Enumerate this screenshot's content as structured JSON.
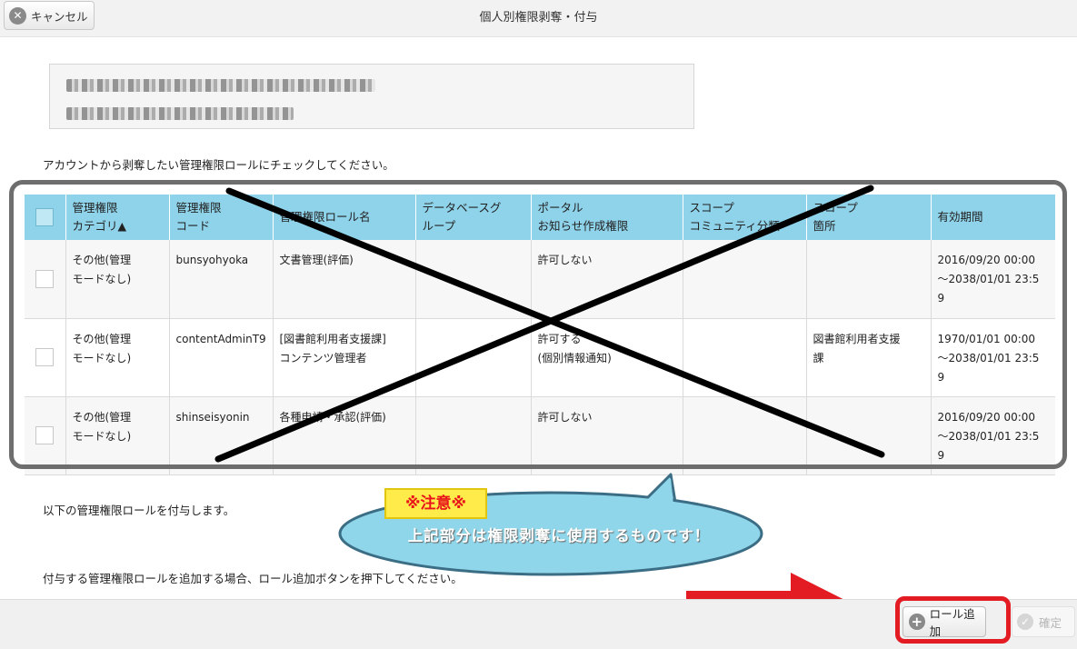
{
  "header": {
    "cancel_label": "キャンセル",
    "title": "個人別権限剥奪・付与"
  },
  "instructions": {
    "revoke": "アカウントから剥奪したい管理権限ロールにチェックしてください。",
    "grant": "以下の管理権限ロールを付与します。",
    "add_hint": "付与する管理権限ロールを追加する場合、ロール追加ボタンを押下してください。"
  },
  "table": {
    "columns": [
      "管理権限\nカテゴリ▲",
      "管理権限\nコード",
      "管理権限ロール名",
      "データベースグ\nループ",
      "ポータル\nお知らせ作成権限",
      "スコープ\nコミュニティ分類",
      "スコープ\n箇所",
      "有効期間"
    ],
    "rows": [
      {
        "category": "その他(管理\nモードなし)",
        "code": "bunsyohyoka",
        "role_name": "文書管理(評価)",
        "db_group": "",
        "portal": "許可しない",
        "scope_community": "",
        "scope_place": "",
        "period": "2016/09/20 00:00\n～2038/01/01 23:5\n9"
      },
      {
        "category": "その他(管理\nモードなし)",
        "code": "contentAdminT9",
        "role_name": "[図書館利用者支援課]\nコンテンツ管理者",
        "db_group": "",
        "portal": "許可する\n(個別情報通知)",
        "scope_community": "",
        "scope_place": "図書館利用者支援\n課",
        "period": "1970/01/01 00:00\n～2038/01/01 23:5\n9"
      },
      {
        "category": "その他(管理\nモードなし)",
        "code": "shinseisyonin",
        "role_name": "各種申請・承認(評価)",
        "db_group": "",
        "portal": "許可しない",
        "scope_community": "",
        "scope_place": "",
        "period": "2016/09/20 00:00\n～2038/01/01 23:5\n9"
      }
    ]
  },
  "callout": {
    "label": "※注意※",
    "text": "上記部分は権限剥奪に使用するものです！"
  },
  "footer": {
    "add_role_label": "ロール追加",
    "confirm_label": "確定"
  },
  "colors": {
    "table_header": "#8fd3ea",
    "annotation_red": "#e31b23",
    "callout_fill": "#8fd6ea",
    "callout_label_bg": "#ffec4a"
  }
}
